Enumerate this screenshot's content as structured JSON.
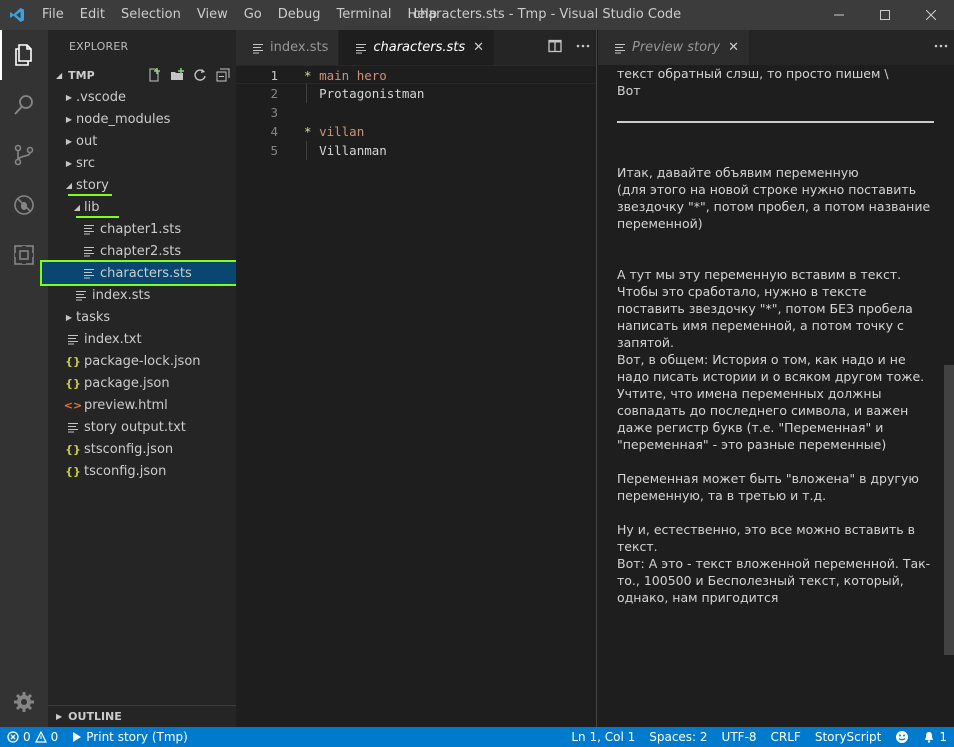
{
  "window": {
    "title": "characters.sts - Tmp - Visual Studio Code",
    "menu": [
      "File",
      "Edit",
      "Selection",
      "View",
      "Go",
      "Debug",
      "Terminal",
      "Help"
    ]
  },
  "sidebar": {
    "title": "EXPLORER",
    "folder": "TMP",
    "items": [
      {
        "label": ".vscode",
        "type": "folder",
        "depth": 0,
        "expanded": false
      },
      {
        "label": "node_modules",
        "type": "folder",
        "depth": 0,
        "expanded": false
      },
      {
        "label": "out",
        "type": "folder",
        "depth": 0,
        "expanded": false
      },
      {
        "label": "src",
        "type": "folder",
        "depth": 0,
        "expanded": false
      },
      {
        "label": "story",
        "type": "folder",
        "depth": 0,
        "expanded": true
      },
      {
        "label": "lib",
        "type": "folder",
        "depth": 1,
        "expanded": true
      },
      {
        "label": "chapter1.sts",
        "type": "file",
        "depth": 2
      },
      {
        "label": "chapter2.sts",
        "type": "file",
        "depth": 2
      },
      {
        "label": "characters.sts",
        "type": "file",
        "depth": 2,
        "selected": true
      },
      {
        "label": "index.sts",
        "type": "file",
        "depth": 1
      },
      {
        "label": "tasks",
        "type": "folder",
        "depth": 0,
        "expanded": false
      },
      {
        "label": "index.txt",
        "type": "file",
        "depth": 0
      },
      {
        "label": "package-lock.json",
        "type": "json",
        "depth": 0
      },
      {
        "label": "package.json",
        "type": "json",
        "depth": 0
      },
      {
        "label": "preview.html",
        "type": "html",
        "depth": 0
      },
      {
        "label": "story output.txt",
        "type": "file",
        "depth": 0
      },
      {
        "label": "stsconfig.json",
        "type": "json",
        "depth": 0
      },
      {
        "label": "tsconfig.json",
        "type": "json",
        "depth": 0
      }
    ],
    "outline": "OUTLINE"
  },
  "editor": {
    "tabs": [
      {
        "label": "index.sts",
        "active": false
      },
      {
        "label": "characters.sts",
        "active": true
      }
    ],
    "lines": [
      {
        "num": "1",
        "star": "*",
        "text": "main hero"
      },
      {
        "num": "2",
        "star": "",
        "text": "Protagonistman"
      },
      {
        "num": "3",
        "star": "",
        "text": ""
      },
      {
        "num": "4",
        "star": "*",
        "text": "villan"
      },
      {
        "num": "5",
        "star": "",
        "text": "Villanman"
      }
    ]
  },
  "preview": {
    "tab": "Preview story",
    "top_lines": [
      "текст обратный слэш, то просто пишем \\",
      "Вот"
    ],
    "paragraphs": [
      "Итак, давайте объявим переменную\n(для этого на новой строке нужно поставить звездочку \"*\", потом пробел, а потом название переменной)",
      "А тут мы эту переменную вставим в текст. Чтобы это сработало, нужно в тексте поставить звездочку \"*\", потом БЕЗ пробела написать имя переменной, а потом точку с запятой.\nВот, в общем: История о том, как надо и не надо писать истории и о всяком другом тоже. Учтите, что имена переменных должны совпадать до последнего символа, и важен даже регистр букв (т.е. \"Переменная\" и \"переменная\" - это разные переменные)",
      "Переменная может быть \"вложена\" в другую переменную, та в третью и т.д.",
      "Ну и, естественно, это все можно вставить в текст.\nВот: А это - текст вложенной переменной. Так-то., 100500 и Бесполезный текст, который, однако, нам пригодится"
    ]
  },
  "statusbar": {
    "errors": "0",
    "warnings": "0",
    "task": "Print story (Tmp)",
    "position": "Ln 1, Col 1",
    "spaces": "Spaces: 2",
    "encoding": "UTF-8",
    "eol": "CRLF",
    "language": "StoryScript",
    "notifications": "1"
  },
  "colors": {
    "accent": "#007acc",
    "highlight": "#7cff1a",
    "selection": "#094771"
  }
}
